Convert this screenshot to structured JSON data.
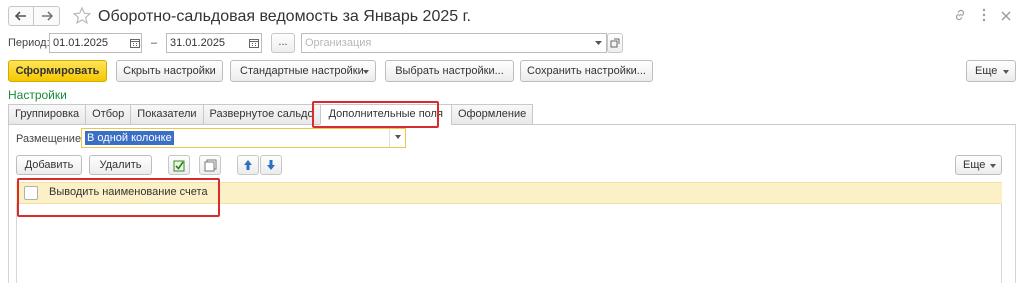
{
  "window": {
    "title": "Оборотно-сальдовая ведомость за Январь 2025 г.",
    "icons": [
      "back-arrow-icon",
      "forward-arrow-icon",
      "star-icon",
      "link-icon",
      "more-vert-icon",
      "close-icon"
    ]
  },
  "filters": {
    "period_label": "Период:",
    "date_from": "01.01.2025",
    "dash": "–",
    "date_to": "31.01.2025",
    "ellipsis_label": "...",
    "organization_placeholder": "Организация"
  },
  "toolbar": {
    "generate_label": "Сформировать",
    "hide_settings_label": "Скрыть настройки",
    "standard_settings_label": "Стандартные настройки",
    "choose_settings_label": "Выбрать настройки...",
    "save_settings_label": "Сохранить настройки...",
    "more_label": "Еще"
  },
  "settings": {
    "title": "Настройки",
    "tabs": [
      {
        "label": "Группировка"
      },
      {
        "label": "Отбор"
      },
      {
        "label": "Показатели"
      },
      {
        "label": "Развернутое сальдо"
      },
      {
        "label": "Дополнительные поля",
        "active": true
      },
      {
        "label": "Оформление"
      }
    ],
    "placement_label": "Размещение:",
    "placement_value": "В одной колонке",
    "add_label": "Добавить",
    "delete_label": "Удалить",
    "more_label": "Еще",
    "fields": [
      {
        "label": "Выводить наименование счета",
        "checked": false
      }
    ]
  },
  "colors": {
    "primary_button": "#f5c800",
    "highlight_box": "#d92b2b",
    "settings_title": "#1a8a3a",
    "row_highlight": "#fbf0c6",
    "selection": "#3a6fc4"
  }
}
